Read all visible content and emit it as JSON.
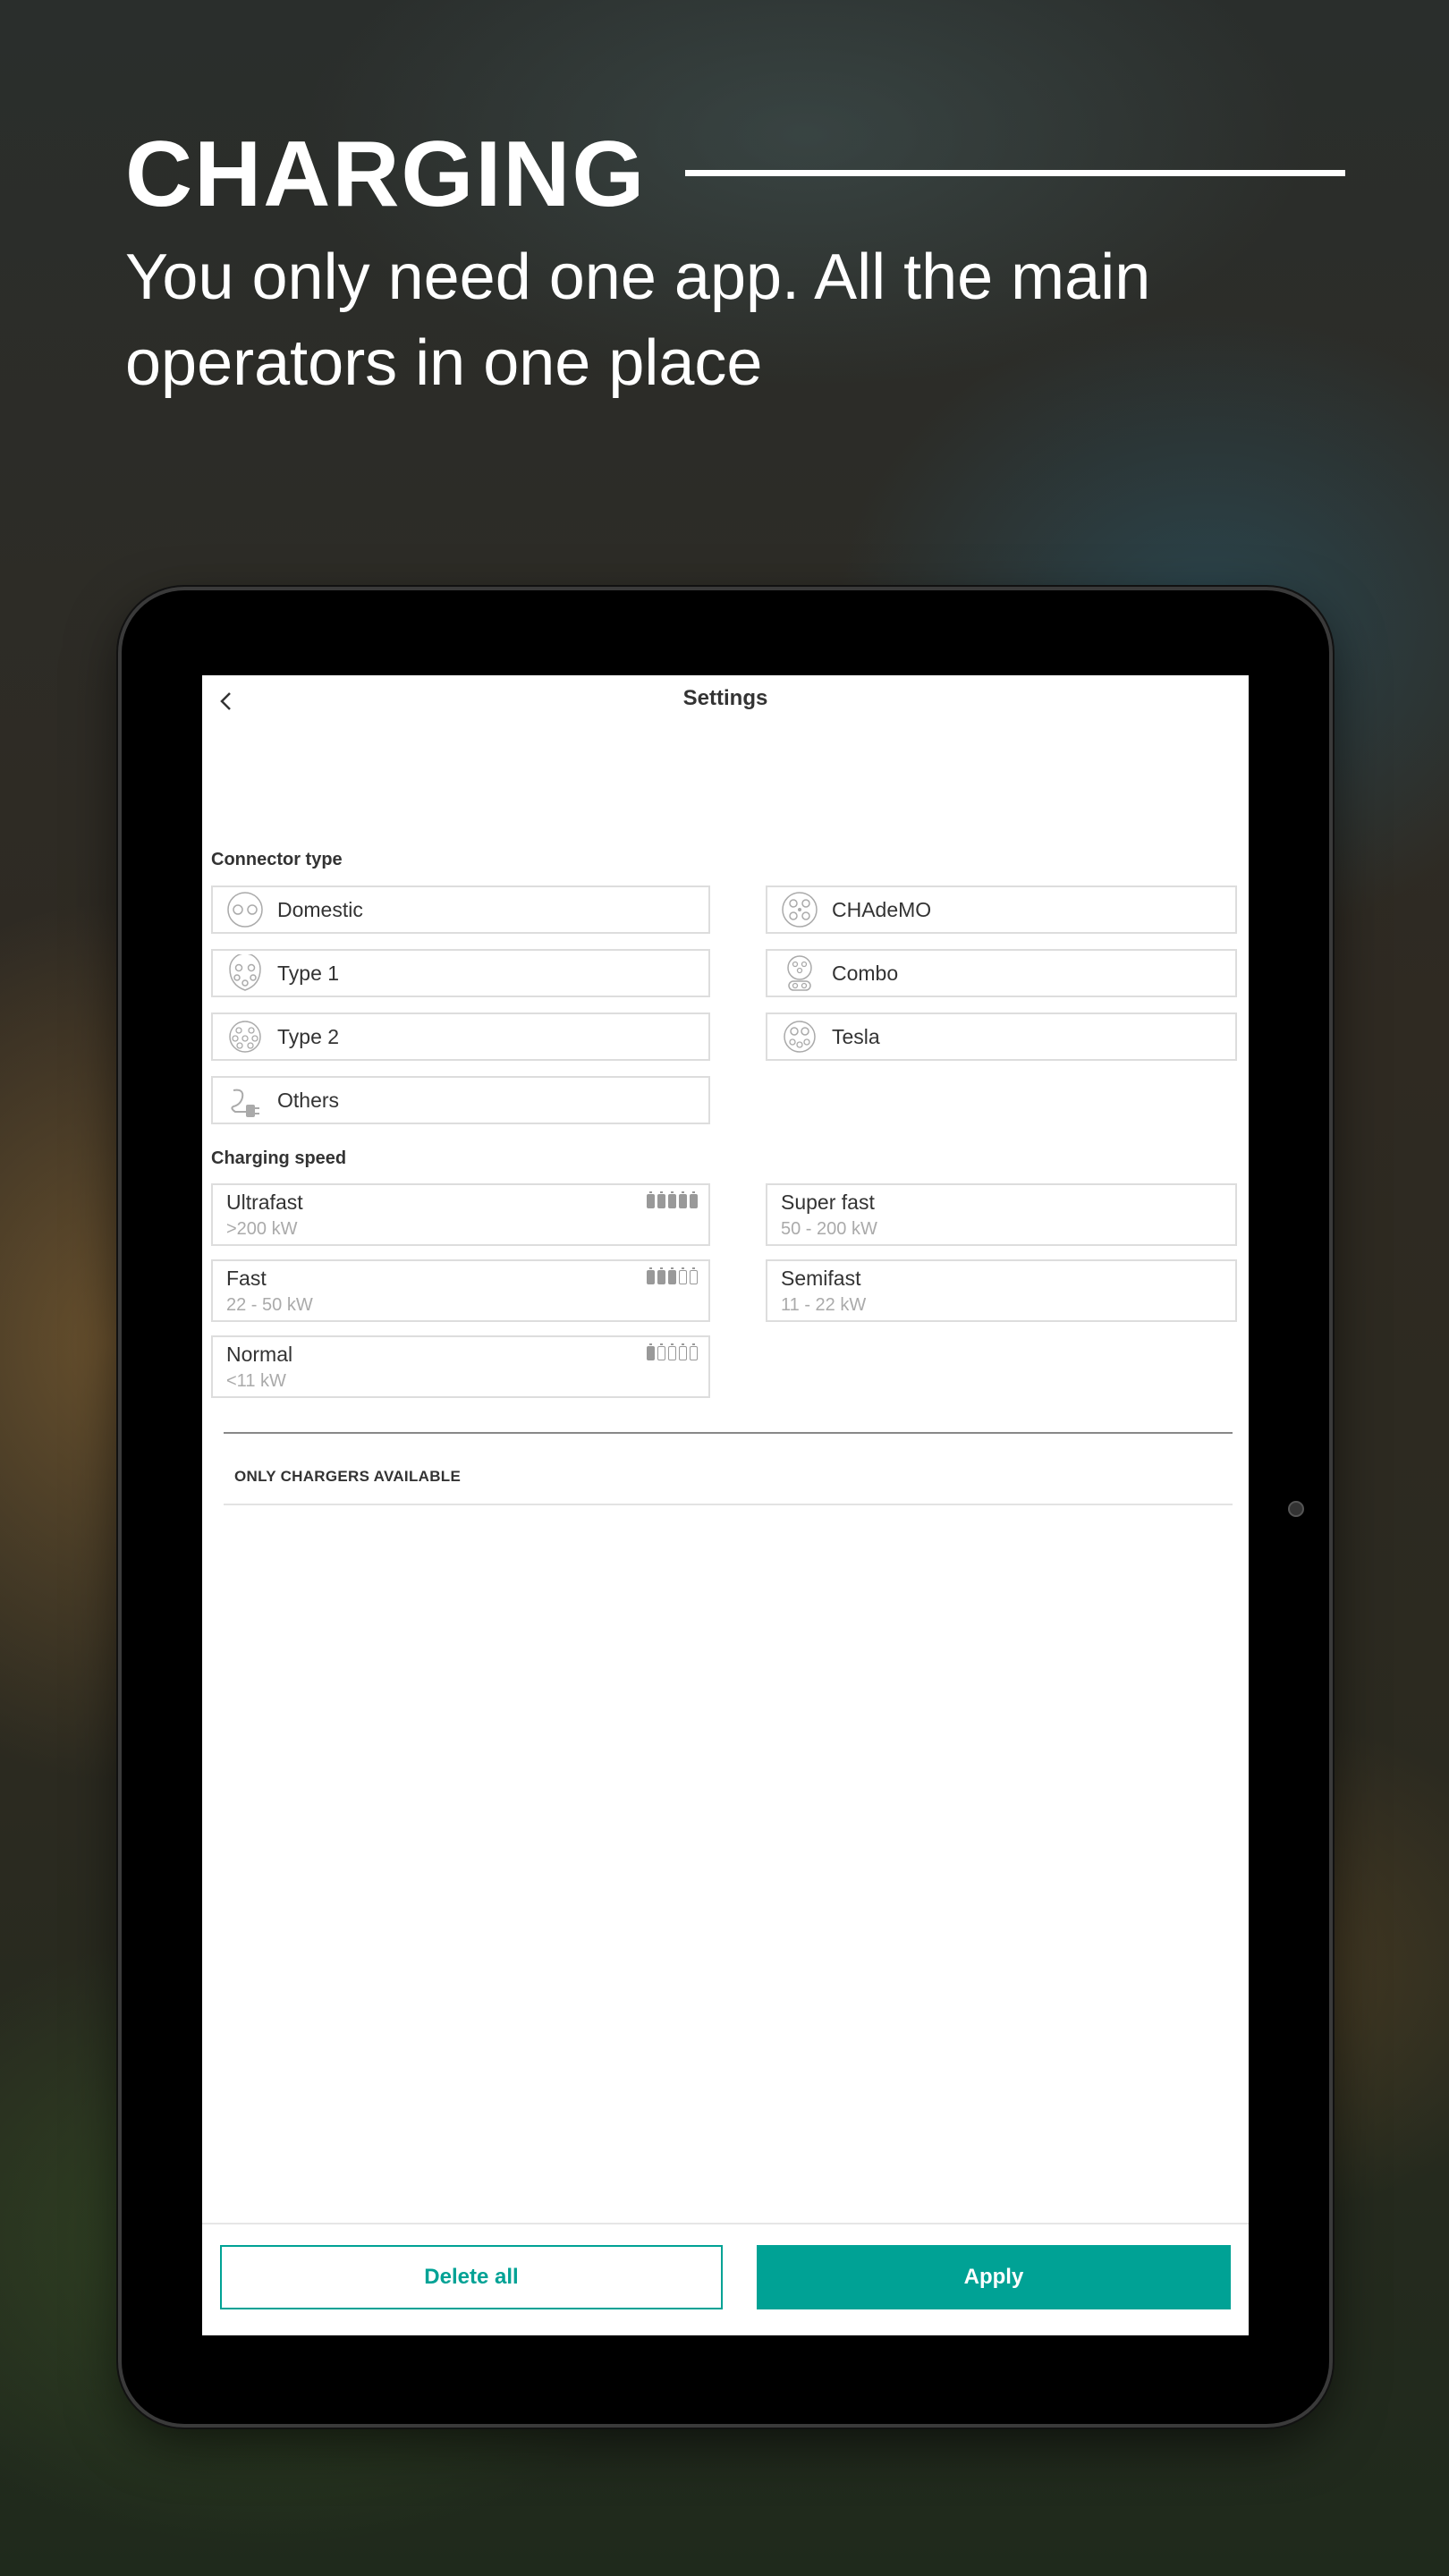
{
  "hero": {
    "title": "CHARGING",
    "subtitle": "You only need one app. All the main operators in one place"
  },
  "screen": {
    "title": "Settings",
    "connector_section": {
      "title": "Connector type",
      "items": [
        {
          "label": "Domestic",
          "icon": "domestic-plug-icon"
        },
        {
          "label": "CHAdeMO",
          "icon": "chademo-plug-icon"
        },
        {
          "label": "Type 1",
          "icon": "type1-plug-icon"
        },
        {
          "label": "Combo",
          "icon": "combo-plug-icon"
        },
        {
          "label": "Type 2",
          "icon": "type2-plug-icon"
        },
        {
          "label": "Tesla",
          "icon": "tesla-plug-icon"
        },
        {
          "label": "Others",
          "icon": "other-plug-icon"
        }
      ]
    },
    "speed_section": {
      "title": "Charging speed",
      "items": [
        {
          "name": "Ultrafast",
          "range": ">200 kW",
          "level": 5
        },
        {
          "name": "Super fast",
          "range": "50 - 200 kW"
        },
        {
          "name": "Fast",
          "range": "22 - 50 kW",
          "level": 3
        },
        {
          "name": "Semifast",
          "range": "11 - 22 kW"
        },
        {
          "name": "Normal",
          "range": "<11 kW",
          "level": 1
        }
      ]
    },
    "availability_label": "ONLY CHARGERS AVAILABLE",
    "buttons": {
      "delete": "Delete all",
      "apply": "Apply"
    },
    "accent_color": "#00a295"
  }
}
